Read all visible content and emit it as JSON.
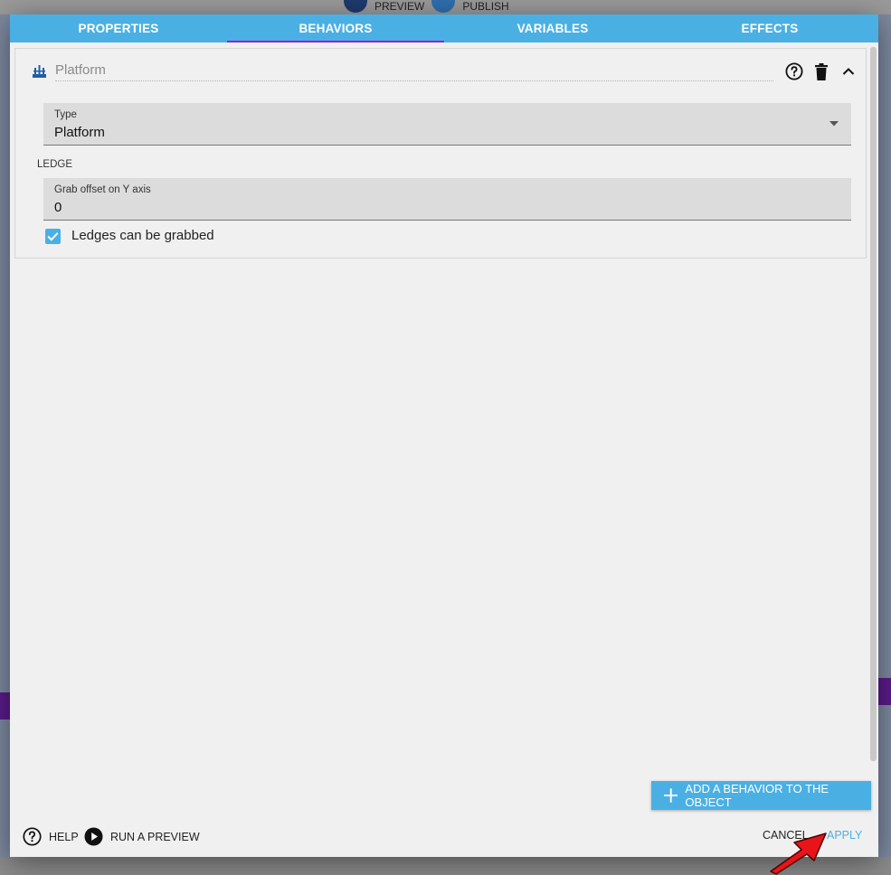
{
  "background": {
    "preview_label": "PREVIEW",
    "publish_label": "PUBLISH"
  },
  "tabs": [
    {
      "label": "PROPERTIES",
      "active": false
    },
    {
      "label": "BEHAVIORS",
      "active": true
    },
    {
      "label": "VARIABLES",
      "active": false
    },
    {
      "label": "EFFECTS",
      "active": false
    }
  ],
  "behavior": {
    "name": "Platform",
    "icon": "platform-behavior-icon",
    "type_field": {
      "label": "Type",
      "value": "Platform"
    },
    "section_label": "LEDGE",
    "grab_offset_field": {
      "label": "Grab offset on Y axis",
      "value": "0"
    },
    "ledges_checkbox": {
      "label": "Ledges can be grabbed",
      "checked": true
    }
  },
  "actions": {
    "add_behavior_label": "ADD A BEHAVIOR TO THE OBJECT",
    "help_label": "HELP",
    "run_preview_label": "RUN A PREVIEW",
    "cancel_label": "CANCEL",
    "apply_label": "APPLY"
  },
  "colors": {
    "accent": "#4ab0e4",
    "active_tab_indicator": "#9b1fd8",
    "dialog_bg": "#f0f0f0"
  }
}
